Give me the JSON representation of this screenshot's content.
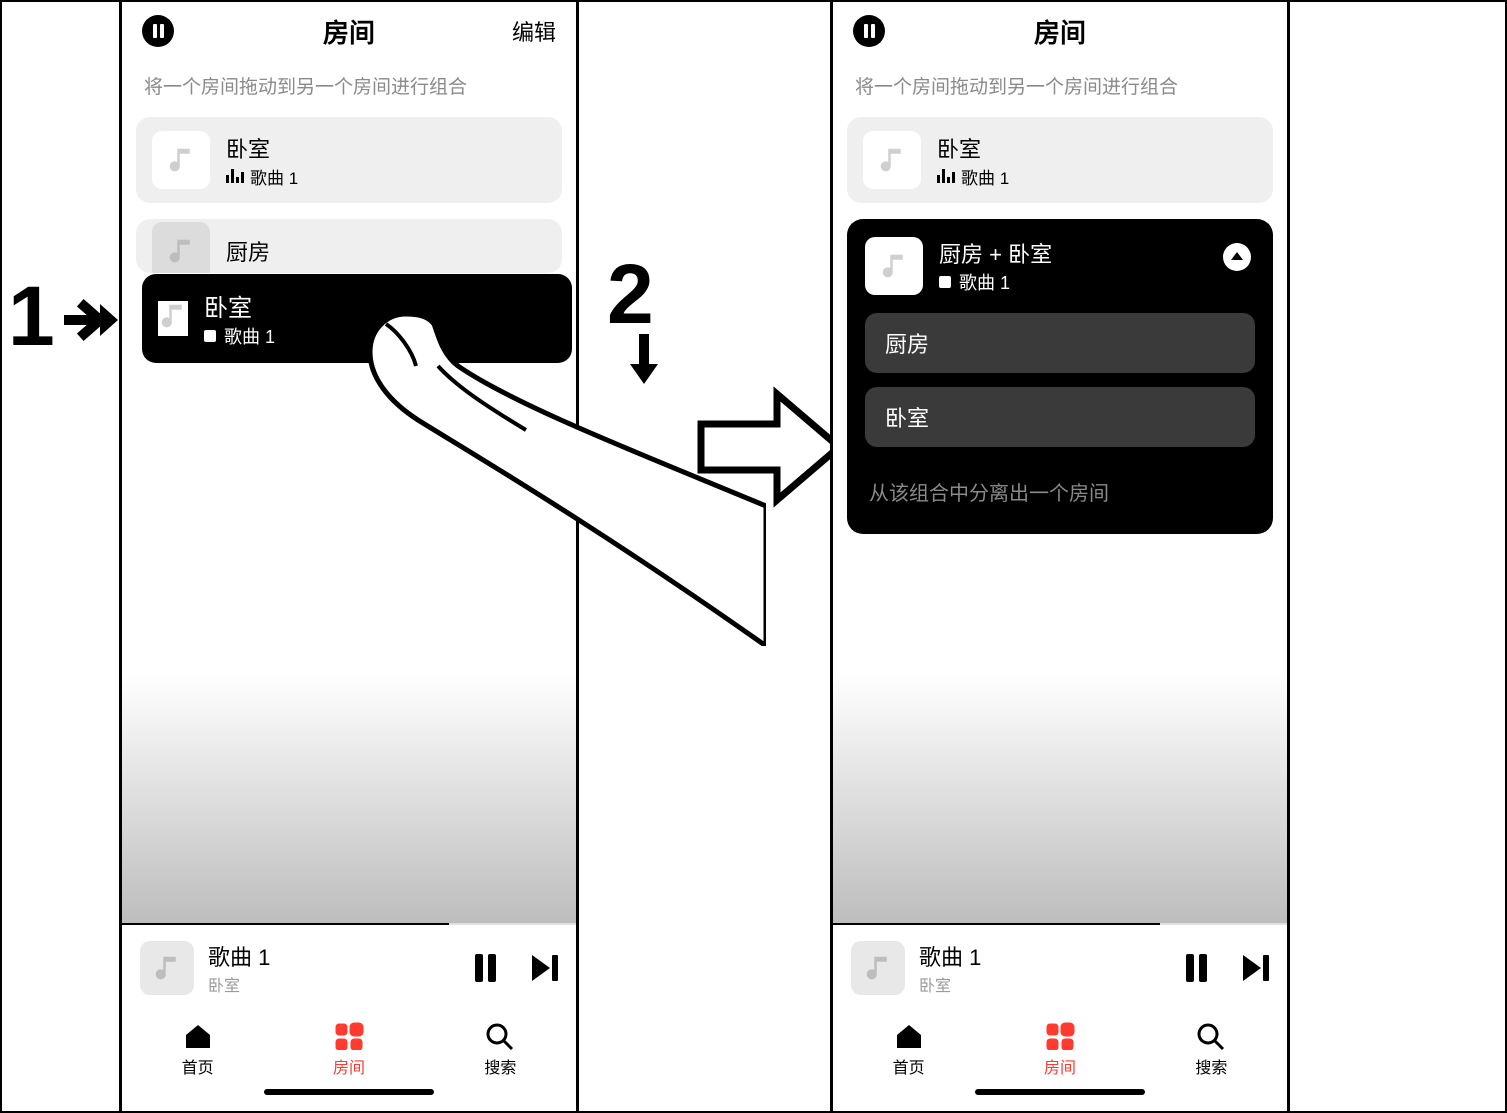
{
  "steps": {
    "one": "1",
    "two": "2"
  },
  "left": {
    "header": {
      "title": "房间",
      "edit": "编辑"
    },
    "hint": "将一个房间拖动到另一个房间进行组合",
    "room1": {
      "name": "卧室",
      "song": "歌曲 1"
    },
    "room2": {
      "name": "厨房"
    },
    "dragging": {
      "name": "卧室",
      "song": "歌曲 1"
    },
    "mini": {
      "song": "歌曲 1",
      "room": "卧室",
      "progress": 72
    },
    "tabs": {
      "home": "首页",
      "rooms": "房间",
      "search": "搜索"
    }
  },
  "right": {
    "header": {
      "title": "房间"
    },
    "hint": "将一个房间拖动到另一个房间进行组合",
    "room1": {
      "name": "卧室",
      "song": "歌曲 1"
    },
    "group": {
      "name": "厨房 + 卧室",
      "song": "歌曲 1",
      "members": [
        "厨房",
        "卧室"
      ],
      "removeHint": "从该组合中分离出一个房间"
    },
    "mini": {
      "song": "歌曲 1",
      "room": "卧室",
      "progress": 72
    },
    "tabs": {
      "home": "首页",
      "rooms": "房间",
      "search": "搜索"
    }
  }
}
